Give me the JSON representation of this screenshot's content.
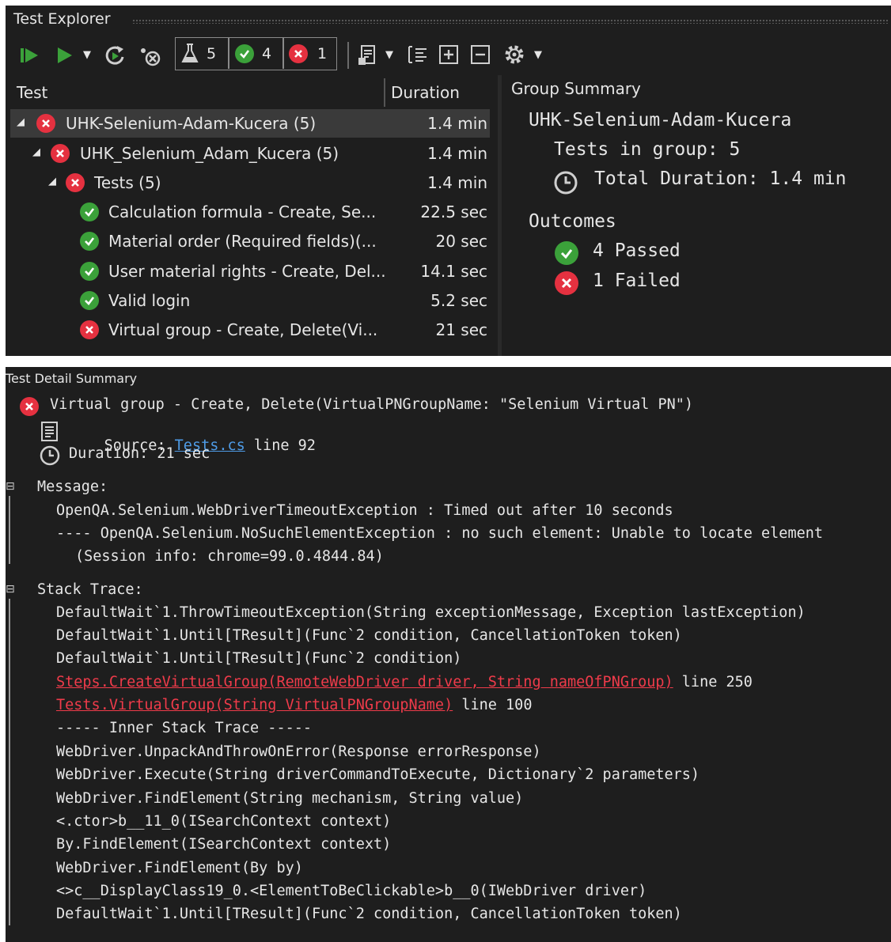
{
  "explorer": {
    "title": "Test Explorer",
    "toolbar": {
      "total_count": "5",
      "passed_count": "4",
      "failed_count": "1"
    },
    "columns": {
      "test": "Test",
      "duration": "Duration"
    },
    "tree": [
      {
        "status": "fail",
        "name": "UHK-Selenium-Adam-Kucera  (5)",
        "duration": "1.4 min"
      },
      {
        "status": "fail",
        "name": "UHK_Selenium_Adam_Kucera  (5)",
        "duration": "1.4 min"
      },
      {
        "status": "fail",
        "name": "Tests  (5)",
        "duration": "1.4 min"
      },
      {
        "status": "pass",
        "name": "Calculation formula - Create, Se...",
        "duration": "22.5 sec"
      },
      {
        "status": "pass",
        "name": "Material order (Required fields)(...",
        "duration": "20 sec"
      },
      {
        "status": "pass",
        "name": "User material rights - Create, Del...",
        "duration": "14.1 sec"
      },
      {
        "status": "pass",
        "name": "Valid login",
        "duration": "5.2 sec"
      },
      {
        "status": "fail",
        "name": "Virtual group - Create, Delete(Vi...",
        "duration": "21 sec"
      }
    ],
    "group_summary": {
      "header": "Group Summary",
      "name": "UHK-Selenium-Adam-Kucera",
      "tests_in_group": "Tests in group: 5",
      "total_duration": "Total Duration: 1.4 min",
      "outcomes_label": "Outcomes",
      "passed": "4 Passed",
      "failed": "1 Failed"
    },
    "colors": {
      "pass": "#3ba13a",
      "fail": "#e53140",
      "background": "#1e1e1e"
    }
  },
  "detail": {
    "title": "Test Detail Summary",
    "test_name": "Virtual group - Create, Delete(VirtualPNGroupName: \"Selenium Virtual PN\")",
    "source_label": "Source:",
    "source_link": "Tests.cs",
    "source_line": "line 92",
    "duration": "Duration: 21 sec",
    "message_label": "Message:",
    "message_lines": [
      "OpenQA.Selenium.WebDriverTimeoutException : Timed out after 10 seconds",
      "---- OpenQA.Selenium.NoSuchElementException : no such element: Unable to locate element",
      "(Session info: chrome=99.0.4844.84)"
    ],
    "stack_label": "Stack Trace:",
    "stack": {
      "line1": "DefaultWait`1.ThrowTimeoutException(String exceptionMessage, Exception lastException)",
      "line2": "DefaultWait`1.Until[TResult](Func`2 condition, CancellationToken token)",
      "line3": "DefaultWait`1.Until[TResult](Func`2 condition)",
      "link1": "Steps.CreateVirtualGroup(RemoteWebDriver driver, String nameOfPNGroup)",
      "link1_suffix": "line 250",
      "link2": "Tests.VirtualGroup(String VirtualPNGroupName)",
      "link2_suffix": "line 100",
      "inner": "----- Inner Stack Trace -----",
      "line4": "WebDriver.UnpackAndThrowOnError(Response errorResponse)",
      "line5": "WebDriver.Execute(String driverCommandToExecute, Dictionary`2 parameters)",
      "line6": "WebDriver.FindElement(String mechanism, String value)",
      "line7": "<.ctor>b__11_0(ISearchContext context)",
      "line8": "By.FindElement(ISearchContext context)",
      "line9": "WebDriver.FindElement(By by)",
      "line10": "<>c__DisplayClass19_0.<ElementToBeClickable>b__0(IWebDriver driver)",
      "line11": "DefaultWait`1.Until[TResult](Func`2 condition, CancellationToken token)"
    }
  }
}
